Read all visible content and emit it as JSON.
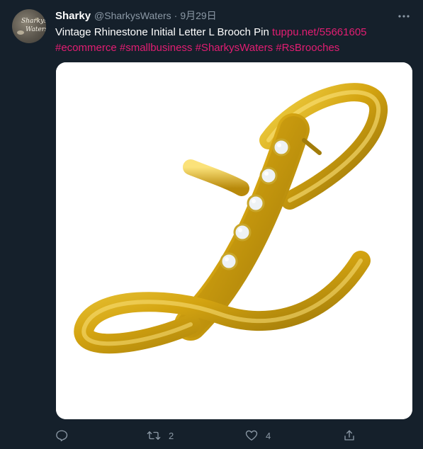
{
  "tweet": {
    "avatar": {
      "name": "avatar",
      "text_line1": "Sharkys",
      "text_line2": "Waters"
    },
    "display_name": "Sharky",
    "handle": "@SharkysWaters",
    "separator": "·",
    "time": "9月29日",
    "text_main": "Vintage Rhinestone Initial Letter L Brooch Pin",
    "link": "tuppu.net/55661605",
    "hashtags": [
      "#ecommerce",
      "#smallbusiness",
      "#SharkysWaters",
      "#RsBrooches"
    ],
    "media": {
      "type": "photo",
      "subject": "gold-tone letter L brooch with rhinestones",
      "colors": {
        "gold": "#d8a918",
        "gold_dark": "#8a6a08",
        "background": "#ffffff"
      }
    },
    "actions": {
      "reply": {
        "icon": "reply-icon",
        "count": ""
      },
      "retweet": {
        "icon": "retweet-icon",
        "count": "2"
      },
      "like": {
        "icon": "like-icon",
        "count": "4"
      },
      "share": {
        "icon": "share-icon"
      }
    }
  },
  "colors": {
    "background": "#15202b",
    "text": "#ffffff",
    "muted": "#8b98a5",
    "link": "#e21d72"
  }
}
